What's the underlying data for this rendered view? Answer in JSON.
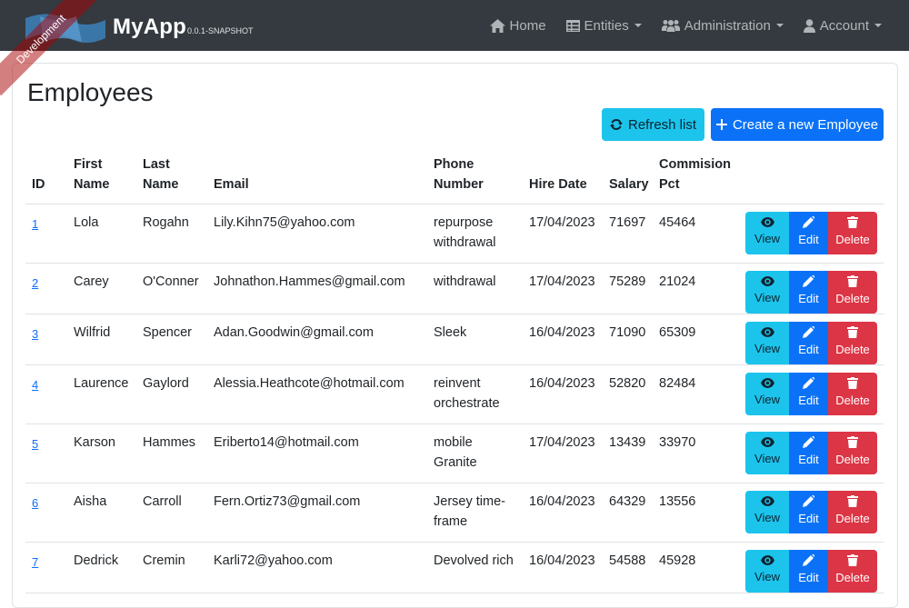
{
  "ribbon": {
    "label": "Development"
  },
  "brand": {
    "name": "MyApp",
    "version": "0.0.1-SNAPSHOT"
  },
  "nav": {
    "items": [
      {
        "label": "Home",
        "icon": "home-icon",
        "dropdown": false
      },
      {
        "label": "Entities",
        "icon": "table-icon",
        "dropdown": true
      },
      {
        "label": "Administration",
        "icon": "users-icon",
        "dropdown": true
      },
      {
        "label": "Account",
        "icon": "user-icon",
        "dropdown": true
      }
    ]
  },
  "page": {
    "title": "Employees",
    "refresh_label": "Refresh list",
    "create_label": "Create a new Employee"
  },
  "table": {
    "headers": {
      "id": "ID",
      "first_name": [
        "First",
        "Name"
      ],
      "last_name": [
        "Last",
        "Name"
      ],
      "email": "Email",
      "phone": [
        "Phone",
        "Number"
      ],
      "hire_date": "Hire Date",
      "salary": "Salary",
      "commission": [
        "Commision",
        "Pct"
      ]
    },
    "action_labels": {
      "view": "View",
      "edit": "Edit",
      "delete": "Delete"
    },
    "rows": [
      {
        "id": "1",
        "first_name": "Lola",
        "last_name": "Rogahn",
        "email": "Lily.Kihn75@yahoo.com",
        "phone": "repurpose withdrawal",
        "hire_date": "17/04/2023",
        "salary": "71697",
        "commission": "45464"
      },
      {
        "id": "2",
        "first_name": "Carey",
        "last_name": "O'Conner",
        "email": "Johnathon.Hammes@gmail.com",
        "phone": "withdrawal",
        "hire_date": "17/04/2023",
        "salary": "75289",
        "commission": "21024"
      },
      {
        "id": "3",
        "first_name": "Wilfrid",
        "last_name": "Spencer",
        "email": "Adan.Goodwin@gmail.com",
        "phone": "Sleek",
        "hire_date": "16/04/2023",
        "salary": "71090",
        "commission": "65309"
      },
      {
        "id": "4",
        "first_name": "Laurence",
        "last_name": "Gaylord",
        "email": "Alessia.Heathcote@hotmail.com",
        "phone": "reinvent orchestrate",
        "hire_date": "16/04/2023",
        "salary": "52820",
        "commission": "82484"
      },
      {
        "id": "5",
        "first_name": "Karson",
        "last_name": "Hammes",
        "email": "Eriberto14@hotmail.com",
        "phone": "mobile Granite",
        "hire_date": "17/04/2023",
        "salary": "13439",
        "commission": "33970"
      },
      {
        "id": "6",
        "first_name": "Aisha",
        "last_name": "Carroll",
        "email": "Fern.Ortiz73@gmail.com",
        "phone": "Jersey time-frame",
        "hire_date": "16/04/2023",
        "salary": "64329",
        "commission": "13556"
      },
      {
        "id": "7",
        "first_name": "Dedrick",
        "last_name": "Cremin",
        "email": "Karli72@yahoo.com",
        "phone": "Devolved rich",
        "hire_date": "16/04/2023",
        "salary": "54588",
        "commission": "45928"
      }
    ]
  },
  "colors": {
    "navbar": "#343a40",
    "info": "#1cc4ec",
    "primary": "#0b72f7",
    "danger": "#dc3545"
  }
}
